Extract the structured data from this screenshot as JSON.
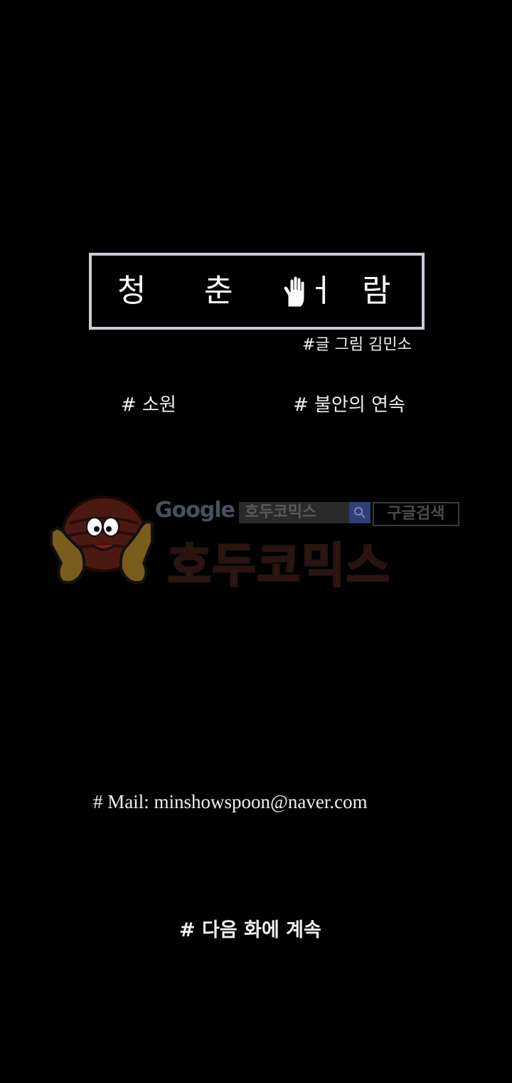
{
  "title": {
    "chars": [
      "청",
      "춘",
      "ㅓ",
      "람"
    ]
  },
  "credit": "#글 그림  김민소",
  "tags": [
    "# 소원",
    "# 불안의 연속"
  ],
  "watermark": {
    "google_label": "Google",
    "search_text": "호두코믹스",
    "search_button": "구글검색",
    "brand": "호두코믹스"
  },
  "mail": "# Mail: minshowspoon@naver.com",
  "next": "# 다음 화에 계속",
  "colors": {
    "background": "#000000",
    "box_border": "#c9ccd6",
    "text": "#f0f0f0"
  }
}
